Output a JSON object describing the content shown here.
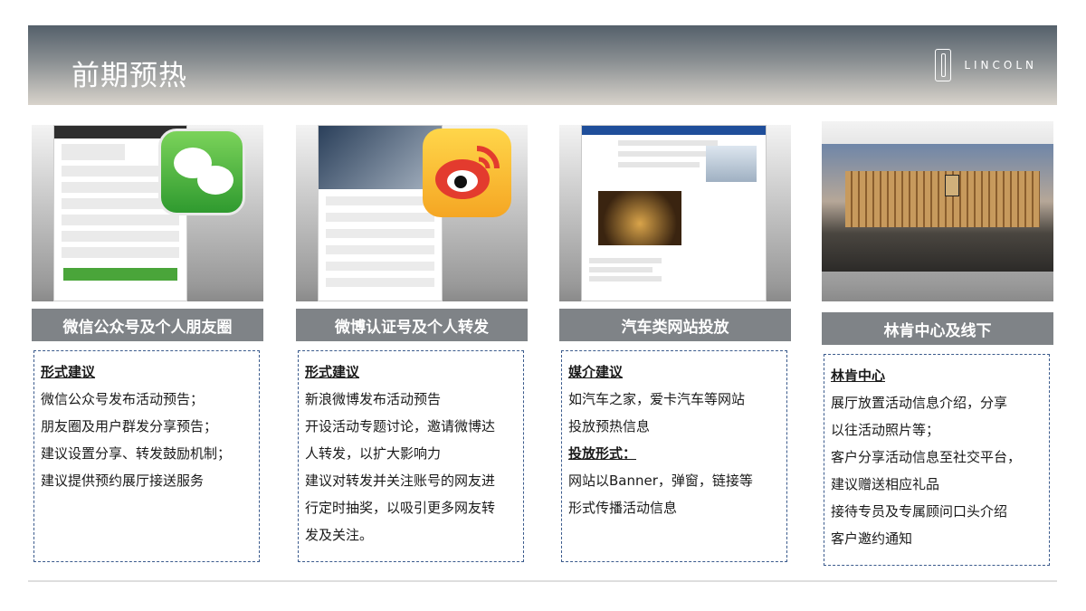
{
  "header": {
    "title": "前期预热",
    "brand": "LINCOLN"
  },
  "columns": [
    {
      "label": "微信公众号及个人朋友圈",
      "image": "wechat-screenshot",
      "lines": [
        {
          "text": "形式建议",
          "heading": true
        },
        {
          "text": "微信公众号发布活动预告；"
        },
        {
          "text": "朋友圈及用户群发分享预告；"
        },
        {
          "text": "建议设置分享、转发鼓励机制；"
        },
        {
          "text": "建议提供预约展厅接送服务"
        }
      ]
    },
    {
      "label": "微博认证号及个人转发",
      "image": "weibo-screenshot",
      "lines": [
        {
          "text": "形式建议",
          "heading": true
        },
        {
          "text": "新浪微博发布活动预告"
        },
        {
          "text": "开设活动专题讨论，邀请微博达"
        },
        {
          "text": "人转发，以扩大影响力"
        },
        {
          "text": "建议对转发并关注账号的网友进"
        },
        {
          "text": "行定时抽奖，以吸引更多网友转"
        },
        {
          "text": "发及关注。"
        }
      ]
    },
    {
      "label": "汽车类网站投放",
      "image": "car-site-screenshot",
      "lines": [
        {
          "text": "媒介建议",
          "heading": true
        },
        {
          "text": "如汽车之家，爱卡汽车等网站"
        },
        {
          "text": "投放预热信息"
        },
        {
          "text": "投放形式：",
          "heading": true
        },
        {
          "text": "网站以Banner，弹窗，链接等"
        },
        {
          "text": "形式传播活动信息"
        }
      ]
    },
    {
      "label": "林肯中心及线下",
      "image": "lincoln-center-photo",
      "lines": [
        {
          "text": "林肯中心",
          "heading": true
        },
        {
          "text": "展厅放置活动信息介绍，分享"
        },
        {
          "text": "以往活动照片等；"
        },
        {
          "text": "客户分享活动信息至社交平台，"
        },
        {
          "text": "建议赠送相应礼品"
        },
        {
          "text": "接待专员及专属顾问口头介绍"
        },
        {
          "text": "客户邀约通知"
        }
      ]
    }
  ]
}
